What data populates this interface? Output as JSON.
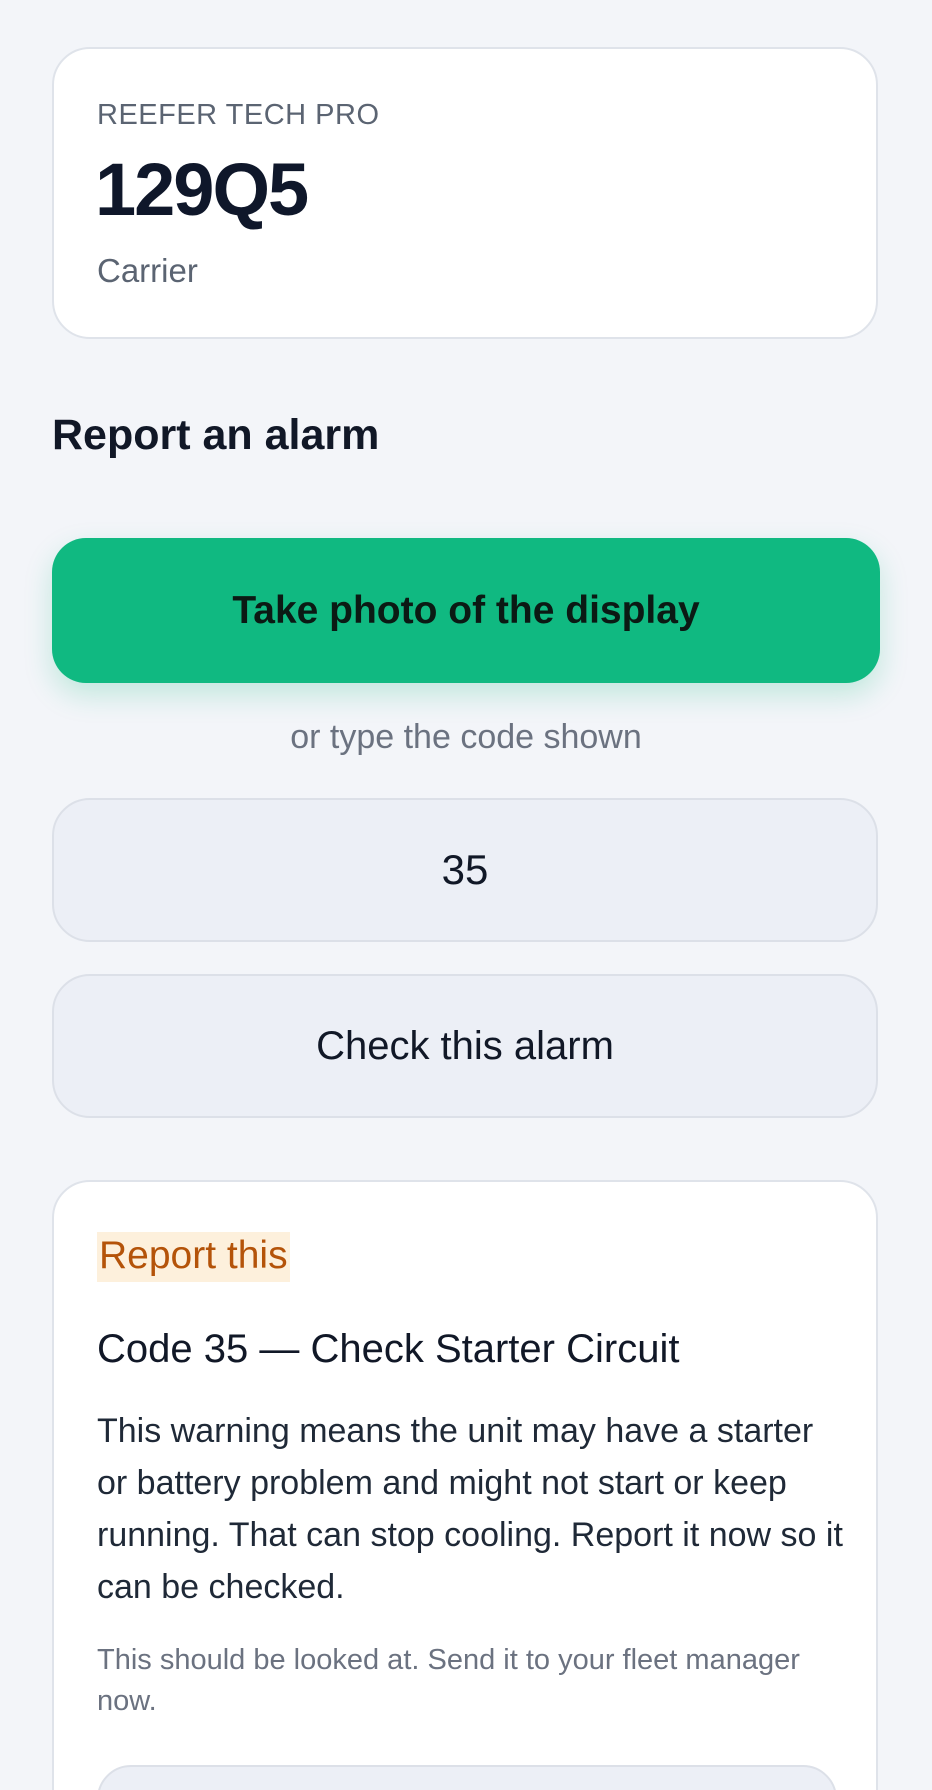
{
  "unit": {
    "brand": "REEFER TECH PRO",
    "model": "129Q5",
    "manufacturer": "Carrier"
  },
  "report": {
    "title": "Report an alarm",
    "photo_button_label": "Take photo of the display",
    "or_text": "or type the code shown",
    "code_value": "35",
    "check_button_label": "Check this alarm"
  },
  "result": {
    "badge": "Report this",
    "title": "Code 35 — Check Starter Circuit",
    "description": "This warning means the unit may have a starter or battery problem and might not start or keep running. That can stop cooling. Report it now so it can be checked.",
    "advice": "This should be looked at. Send it to your fleet manager now."
  },
  "colors": {
    "accent": "#10b981",
    "warning_text": "#b45309",
    "warning_bg": "#fdf0dc",
    "page_bg": "#f3f5f9"
  }
}
